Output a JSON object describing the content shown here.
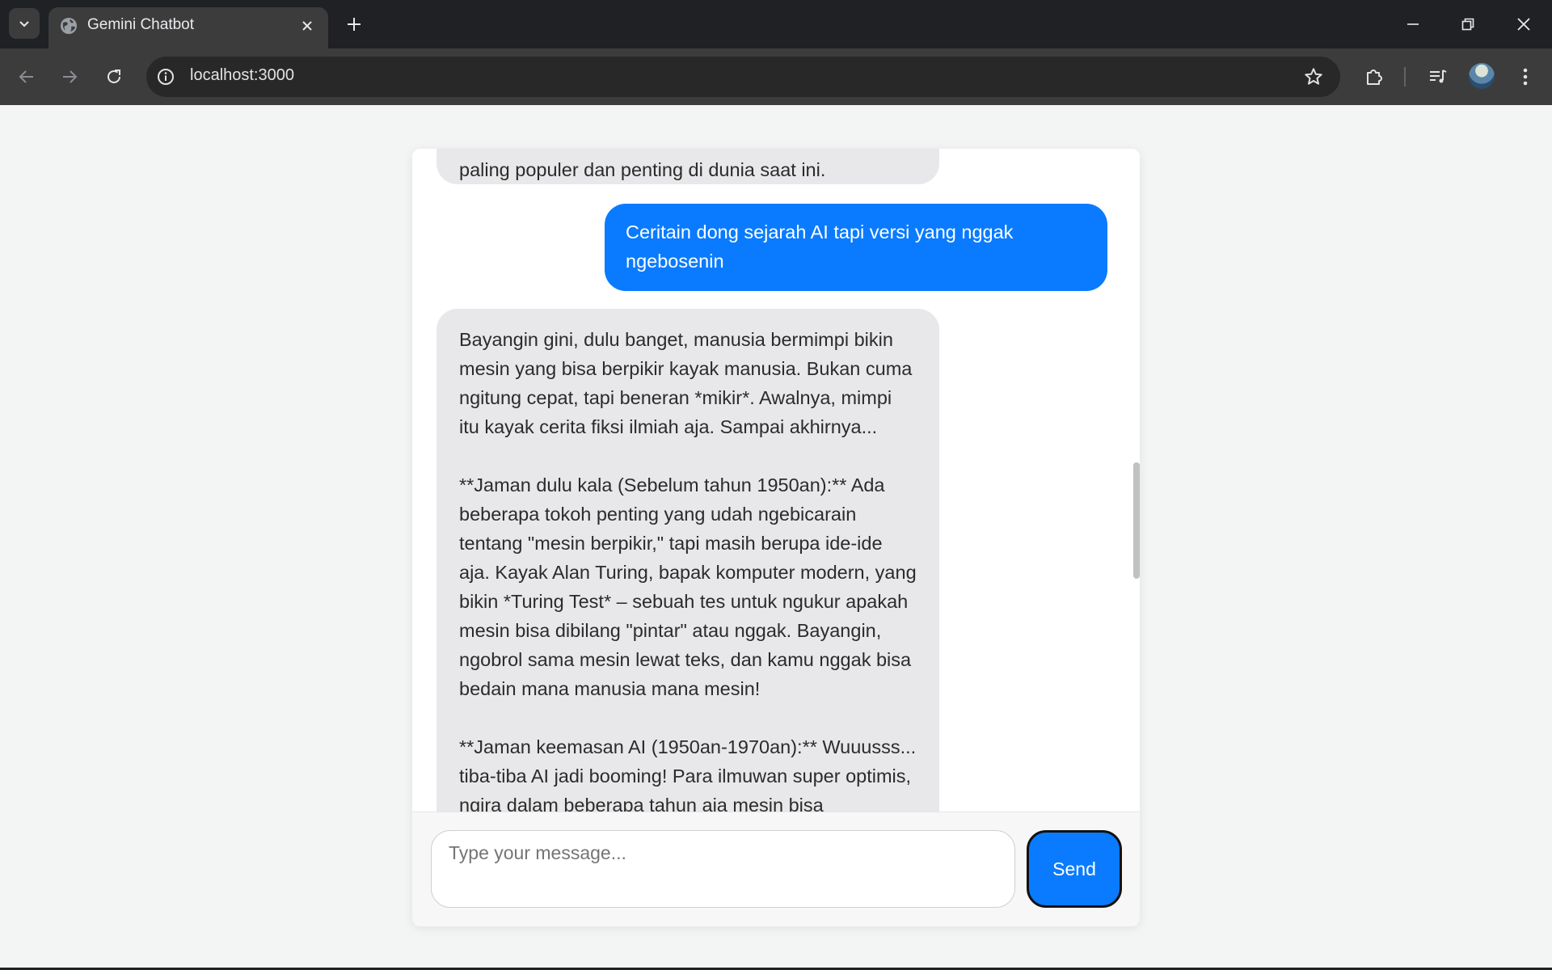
{
  "browser": {
    "tab_title": "Gemini Chatbot",
    "url": "localhost:3000"
  },
  "icons": {
    "tab_favicon": "globe-icon",
    "back": "arrow-left-icon",
    "forward": "arrow-right-icon",
    "reload": "reload-icon",
    "site_info": "info-icon",
    "bookmark": "star-icon",
    "extensions": "puzzle-icon",
    "media": "media-queue-icon",
    "menu": "kebab-menu-icon"
  },
  "chat": {
    "messages": [
      {
        "role": "bot",
        "text": "paling populer dan penting di dunia saat ini."
      },
      {
        "role": "user",
        "text": "Ceritain dong sejarah AI tapi versi yang nggak ngebosenin"
      },
      {
        "role": "bot",
        "text": "Bayangin gini, dulu banget, manusia bermimpi bikin mesin yang bisa berpikir kayak manusia.  Bukan cuma ngitung cepat, tapi beneran *mikir*.  Awalnya, mimpi itu kayak cerita fiksi ilmiah aja.  Sampai akhirnya...\n\n**Jaman dulu kala (Sebelum tahun 1950an):**  Ada beberapa tokoh penting yang udah ngebicarain tentang \"mesin berpikir,\" tapi masih berupa ide-ide aja.  Kayak Alan Turing, bapak komputer modern, yang bikin *Turing Test* – sebuah tes untuk ngukur apakah mesin bisa dibilang \"pintar\" atau nggak.  Bayangin, ngobrol sama mesin lewat teks, dan kamu nggak bisa bedain mana manusia mana mesin!\n\n**Jaman keemasan AI (1950an-1970an):**  Wuuusss... tiba-tiba AI jadi booming!  Para ilmuwan super optimis,  ngira dalam beberapa tahun aja mesin bisa"
      }
    ],
    "input_placeholder": "Type your message...",
    "input_value": "",
    "send_label": "Send"
  },
  "colors": {
    "user_bubble": "#0a7bff",
    "bot_bubble": "#e8e8ea",
    "send_button": "#0a7bff",
    "page_background": "#f3f4f4"
  }
}
